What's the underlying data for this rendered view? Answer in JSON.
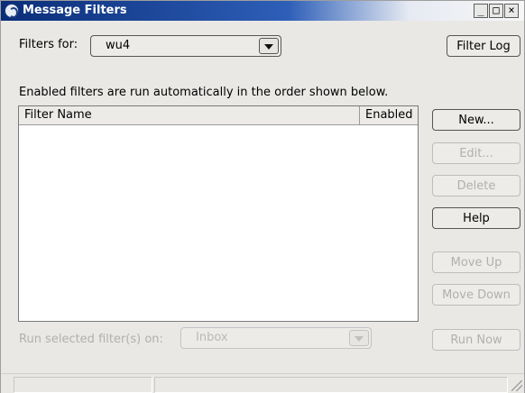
{
  "window": {
    "title": "Message Filters",
    "controls": {
      "minimize": "_",
      "maximize": "□",
      "close": "×"
    }
  },
  "filters_for": {
    "label": "Filters for:",
    "value": "wu4"
  },
  "filter_log_button": "Filter Log",
  "description": "Enabled filters are run automatically in the order shown below.",
  "table": {
    "columns": [
      "Filter Name",
      "Enabled"
    ],
    "rows": []
  },
  "side_buttons": {
    "new": "New...",
    "edit": "Edit...",
    "delete": "Delete",
    "help": "Help",
    "move_up": "Move Up",
    "move_down": "Move Down"
  },
  "run_selected": {
    "label": "Run selected filter(s) on:",
    "folder": "Inbox",
    "run_now": "Run Now"
  },
  "colors": {
    "title_gradient_start": "#0a2d78",
    "title_gradient_end": "#f7f7f7",
    "window_bg": "#e9e8e5",
    "disabled_text": "#b0b0b0"
  }
}
